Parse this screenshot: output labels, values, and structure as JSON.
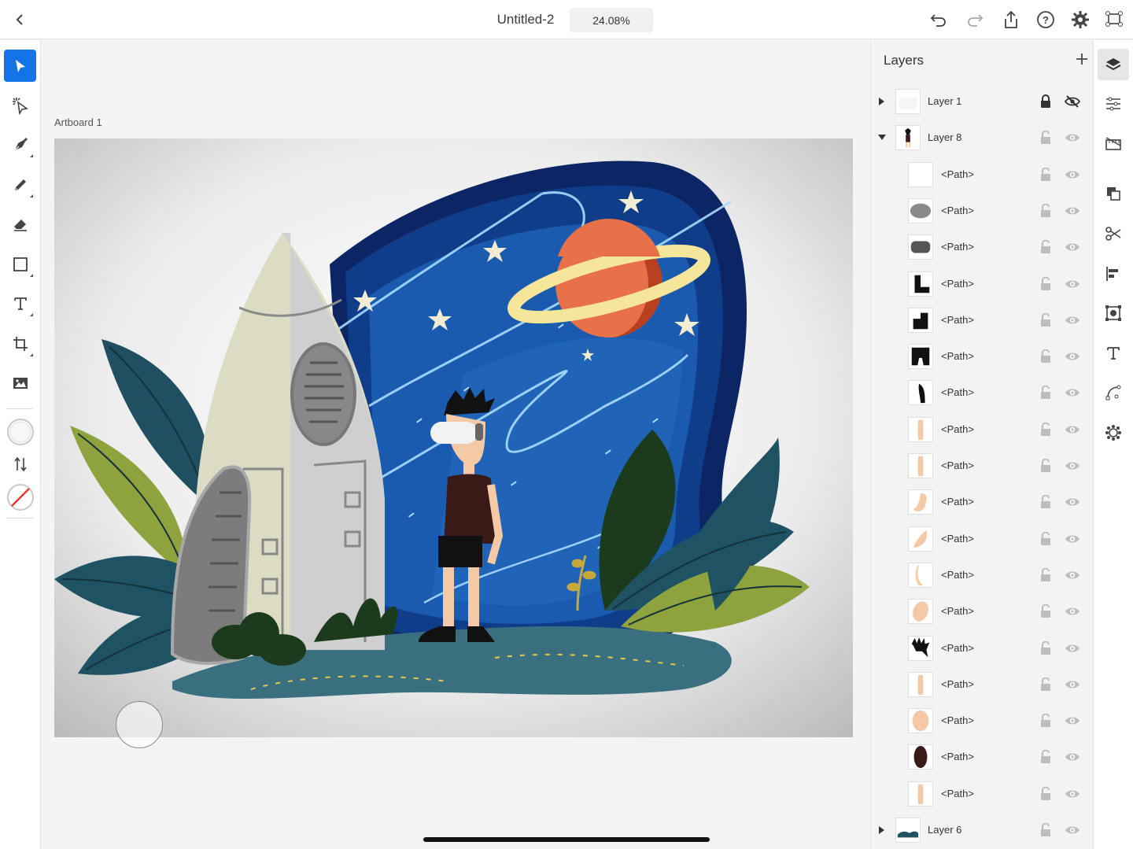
{
  "header": {
    "title": "Untitled-2",
    "zoom": "24.08%",
    "icons": [
      "chevron-left-icon",
      "undo-icon",
      "redo-icon",
      "share-icon",
      "help-icon",
      "gear-icon",
      "artboards-icon"
    ]
  },
  "tools": {
    "items": [
      "select-icon",
      "direct-select-icon",
      "pen-icon",
      "pencil-icon",
      "eraser-icon",
      "rectangle-icon",
      "type-icon",
      "transform-icon",
      "image-icon"
    ],
    "active": "select-icon",
    "fill_color": "#ffffff",
    "stroke": "none"
  },
  "canvas": {
    "artboard_label": "Artboard 1"
  },
  "layers": {
    "title": "Layers",
    "rows": [
      {
        "name": "Layer 1",
        "kind": "layer",
        "expanded": false,
        "locked": true,
        "visible": false
      },
      {
        "name": "Layer 8",
        "kind": "layer",
        "expanded": true,
        "locked": false,
        "visible": true
      },
      {
        "name": "<Path>",
        "kind": "path"
      },
      {
        "name": "<Path>",
        "kind": "path"
      },
      {
        "name": "<Path>",
        "kind": "path"
      },
      {
        "name": "<Path>",
        "kind": "path"
      },
      {
        "name": "<Path>",
        "kind": "path"
      },
      {
        "name": "<Path>",
        "kind": "path"
      },
      {
        "name": "<Path>",
        "kind": "path"
      },
      {
        "name": "<Path>",
        "kind": "path"
      },
      {
        "name": "<Path>",
        "kind": "path"
      },
      {
        "name": "<Path>",
        "kind": "path"
      },
      {
        "name": "<Path>",
        "kind": "path"
      },
      {
        "name": "<Path>",
        "kind": "path"
      },
      {
        "name": "<Path>",
        "kind": "path"
      },
      {
        "name": "<Path>",
        "kind": "path"
      },
      {
        "name": "<Path>",
        "kind": "path"
      },
      {
        "name": "<Path>",
        "kind": "path"
      },
      {
        "name": "<Path>",
        "kind": "path"
      },
      {
        "name": "<Path>",
        "kind": "path"
      },
      {
        "name": "Layer 6",
        "kind": "layer",
        "expanded": false,
        "locked": false,
        "visible": true
      }
    ]
  },
  "right_rail": {
    "items": [
      "layers-icon",
      "properties-icon",
      "grid-icon",
      "arrange-icon",
      "scissors-icon",
      "align-icon",
      "repeat-grid-icon",
      "type-properties-icon",
      "path-icon",
      "symbols-icon"
    ],
    "active": "layers-icon"
  },
  "colors": {
    "accent": "#1473e6",
    "night_sky": "#0b2a66",
    "planet": "#e8714a",
    "ring": "#f6e69a"
  }
}
